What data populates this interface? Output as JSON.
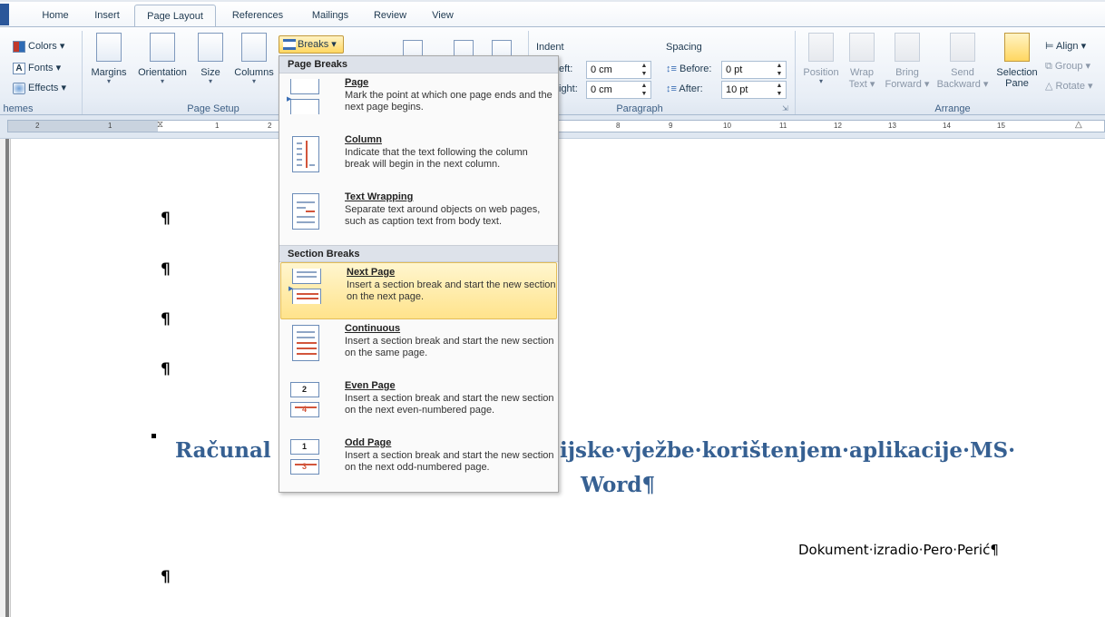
{
  "tabs": [
    "Home",
    "Insert",
    "Page Layout",
    "References",
    "Mailings",
    "Review",
    "View"
  ],
  "active_tab": "Page Layout",
  "ribbon": {
    "themes": {
      "colors": "Colors",
      "fonts": "Fonts",
      "effects": "Effects",
      "label": "hemes"
    },
    "page_setup": {
      "margins": "Margins",
      "orientation": "Orientation",
      "size": "Size",
      "columns": "Columns",
      "breaks": "Breaks",
      "label": "Page Setup"
    },
    "paragraph": {
      "indent": "Indent",
      "left_label": "eft:",
      "left_value": "0 cm",
      "right_label": "ight:",
      "right_value": "0 cm",
      "spacing": "Spacing",
      "before_label": "Before:",
      "before_value": "0 pt",
      "after_label": "After:",
      "after_value": "10 pt",
      "label": "Paragraph"
    },
    "arrange": {
      "position": "Position",
      "wrap": "Wrap",
      "text": "Text",
      "bring": "Bring",
      "forward": "Forward",
      "send": "Send",
      "backward": "Backward",
      "selection": "Selection",
      "pane": "Pane",
      "align": "Align",
      "group": "Group",
      "rotate": "Rotate",
      "label": "Arrange"
    }
  },
  "ruler_numbers": [
    "2",
    "1",
    "1",
    "2",
    "8",
    "9",
    "10",
    "11",
    "12",
    "13",
    "14",
    "15"
  ],
  "breaks_menu": {
    "page_breaks_header": "Page Breaks",
    "section_breaks_header": "Section Breaks",
    "items": [
      {
        "title": "Page",
        "desc": "Mark the point at which one page ends and the next page begins."
      },
      {
        "title": "Column",
        "desc": "Indicate that the text following the column break will begin in the next column."
      },
      {
        "title": "Text Wrapping",
        "desc": "Separate text around objects on web pages, such as caption text from body text."
      },
      {
        "title": "Next Page",
        "desc": "Insert a section break and start the new section on the next page."
      },
      {
        "title": "Continuous",
        "desc": "Insert a section break and start the new section on the same page."
      },
      {
        "title": "Even Page",
        "desc": "Insert a section break and start the new section on the next even-numbered page."
      },
      {
        "title": "Odd Page",
        "desc": "Insert a section break and start the new section on the next odd-numbered page."
      }
    ],
    "even_num_top": "2",
    "even_num_bottom": "4",
    "odd_num_top": "1",
    "odd_num_bottom": "3"
  },
  "document": {
    "pilcrow": "¶",
    "title_left": "Računal",
    "title_right": "ijske·vježbe·korištenjem·aplikacije·MS·",
    "title_line2": "Word¶",
    "author": "Dokument·izradio·Pero·Perić¶"
  },
  "colors": {
    "accent": "#2b579a",
    "highlight": "#ffe38b",
    "title": "#366092"
  }
}
